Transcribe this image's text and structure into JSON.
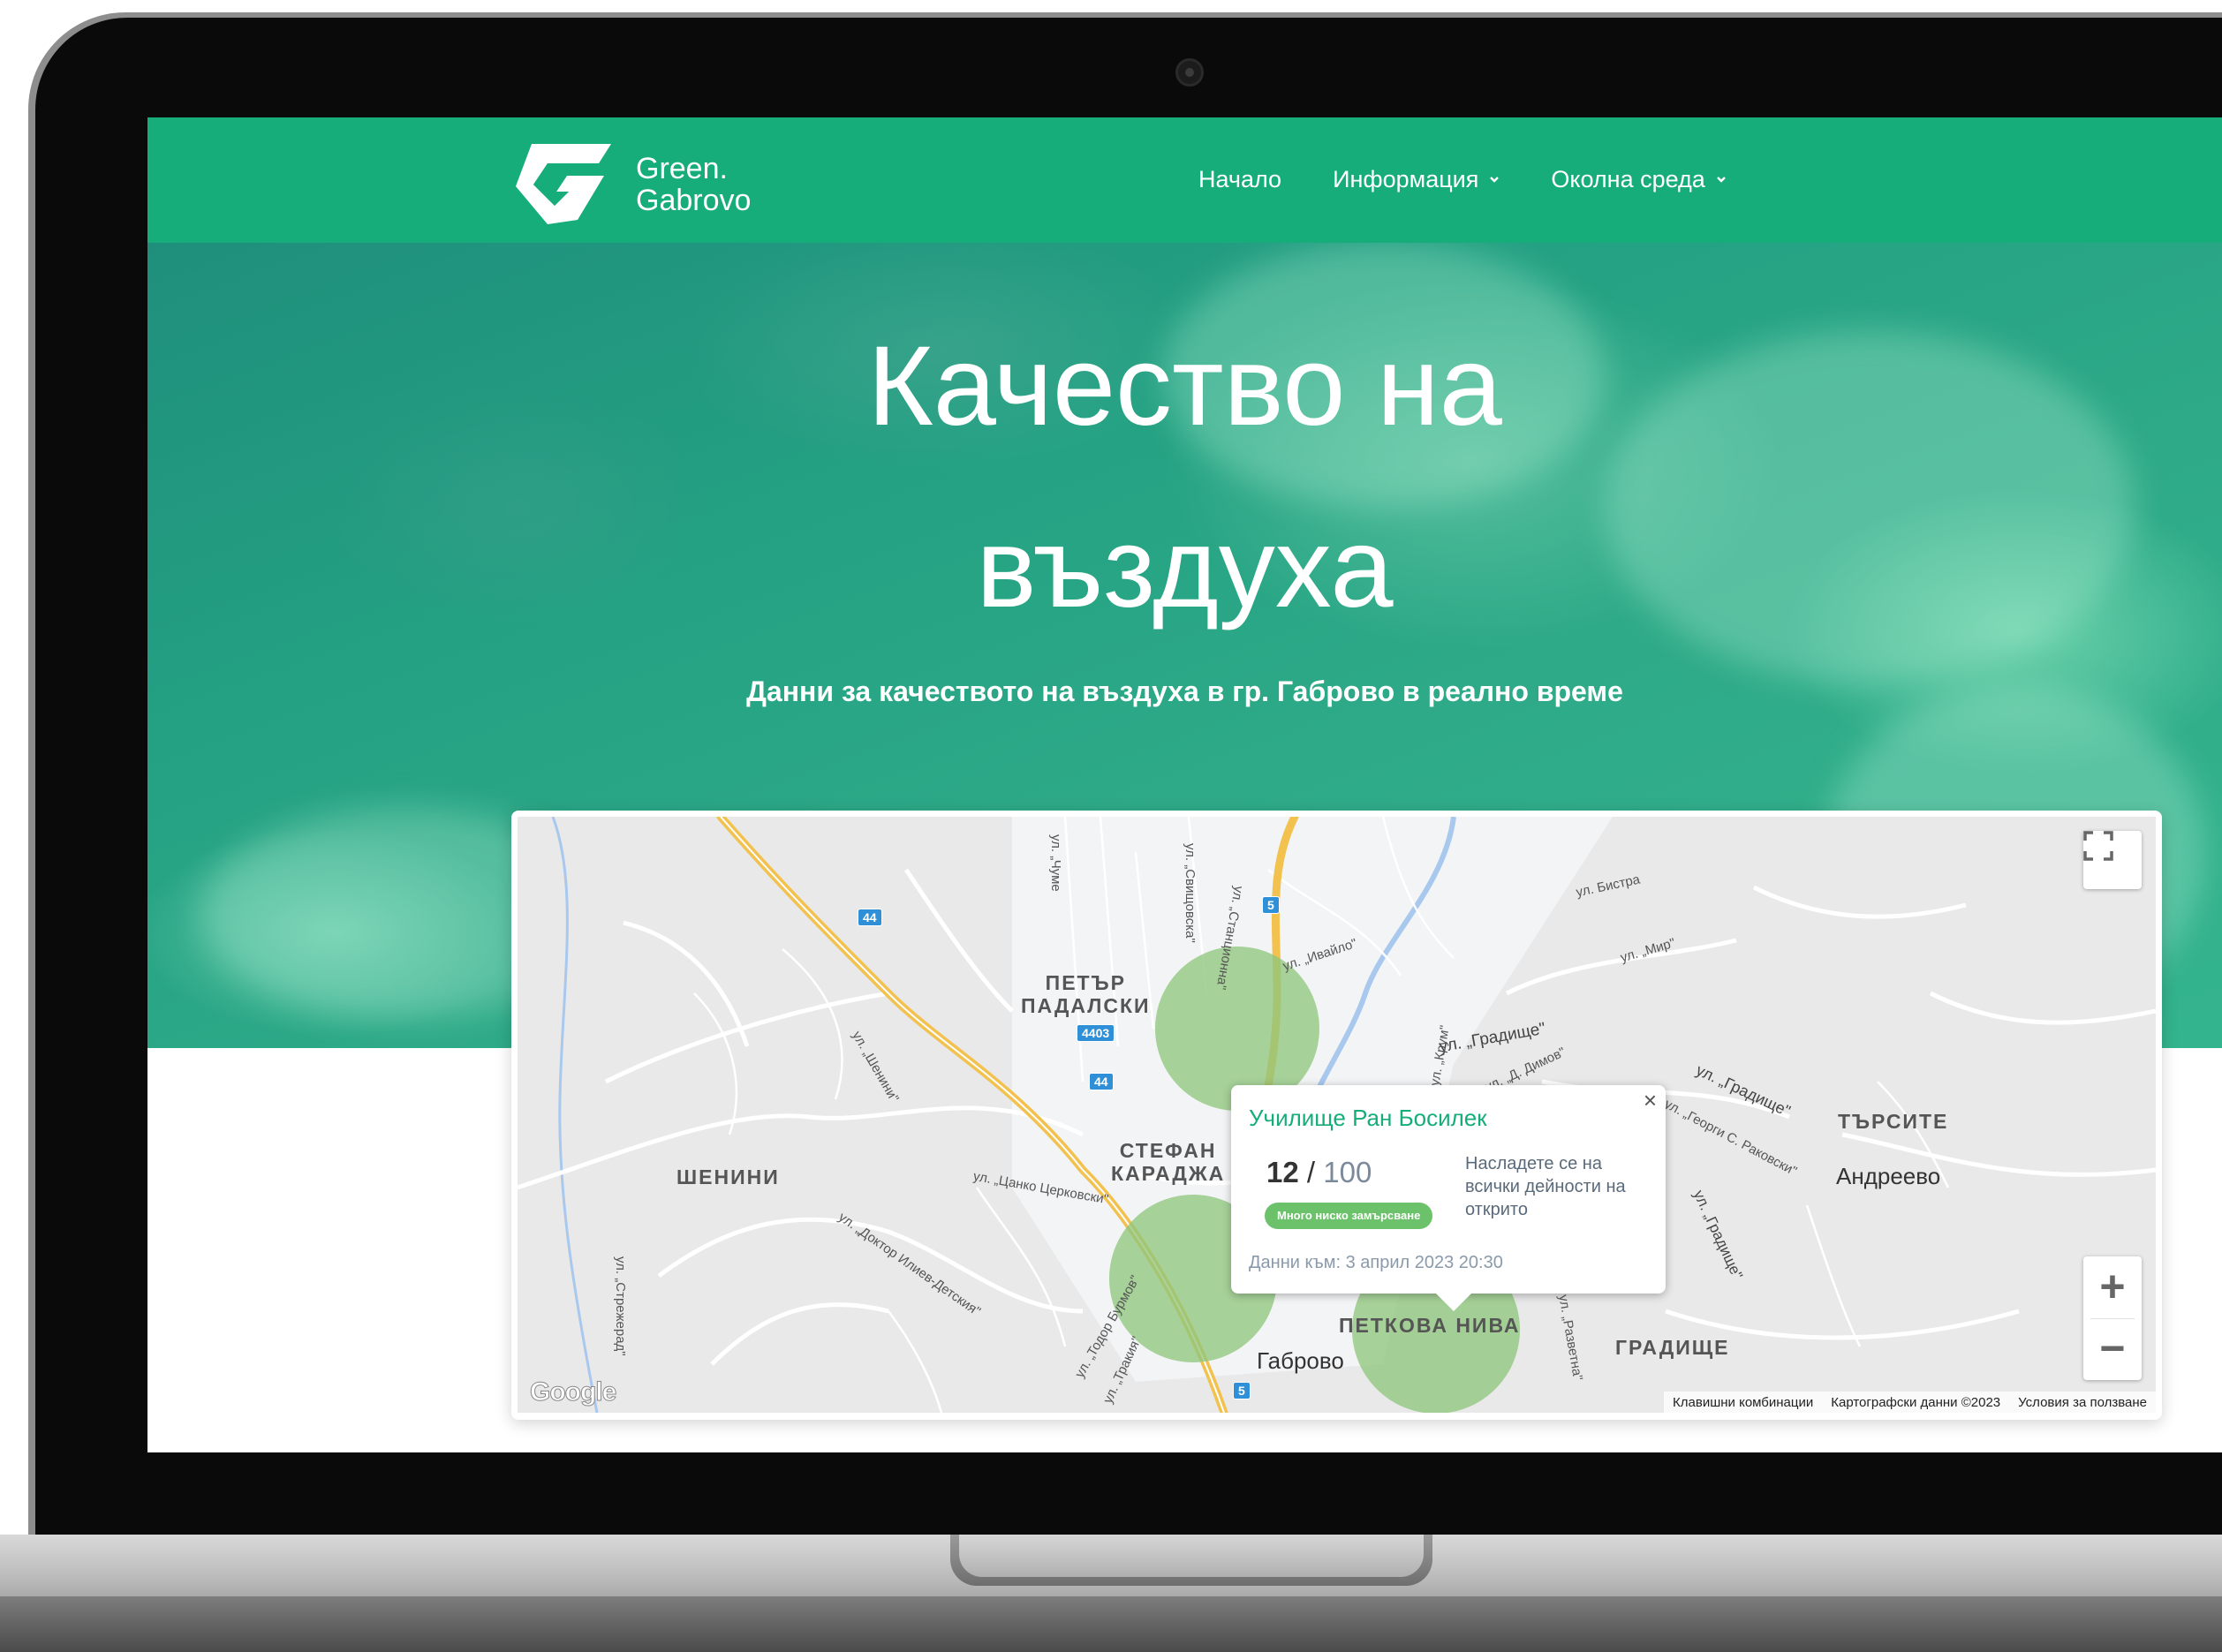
{
  "brand": {
    "line1": "Green.",
    "line2": "Gabrovo"
  },
  "nav": {
    "items": [
      {
        "label": "Начало"
      },
      {
        "label": "Информация"
      },
      {
        "label": "Околна среда"
      }
    ]
  },
  "hero": {
    "title_line1": "Качество на",
    "title_line2": "въздуха",
    "subtitle": "Данни за качеството на въздуха в гр. Габрово в реално време"
  },
  "map": {
    "labels": {
      "petar": "ПЕТЪР\nПАДАЛСКИ",
      "shenini": "ШЕНИНИ",
      "stefan": "СТЕФАН\nКАРАДЖА",
      "tarsite": "ТЪРСИТЕ",
      "andreevo": "Андреево",
      "petkova": "ПЕТКОВА НИВА",
      "gradishte": "ГРАДИЩЕ",
      "gabrovo": "Габрово"
    },
    "streets": {
      "chumeska": "ул. „Чуме",
      "svishtovska": "ул. „Свищовска\"",
      "stantsionna": "ул. „Станционна\"",
      "ivaylo": "ул. „Ивайло\"",
      "bistra": "ул. Бистра",
      "mir": "ул. „Мир\"",
      "gradishte1": "ул. „Градище\"",
      "gradishte2": "ул. „Градище\"",
      "gradishte3": "ул. „Градище\"",
      "sheynin": "ул. „Шенини\"",
      "tsanko": "ул. „Цанко Церковски\"",
      "doktor": "ул. „Доктор Илиев-Детския\"",
      "strezherad": "ул. „Стрежерад\"",
      "todor": "ул. „Тодор Бурмов\"",
      "trakiya": "ул. „Тракия\"",
      "rakovski": "ул. „Георги С. Раковски\"",
      "razvetna": "ул. „Разветна\"",
      "dimov": "ул. „Д. Димов\"",
      "krum": "ул. „Крум\""
    },
    "shields": {
      "s44a": "44",
      "s44b": "44",
      "s4403": "4403",
      "s5a": "5",
      "s5b": "5"
    },
    "attribution": {
      "shortcuts": "Клавишни комбинации",
      "data": "Картографски данни ©2023",
      "terms": "Условия за ползване"
    },
    "google": "Google",
    "zoom_in": "+",
    "zoom_out": "−"
  },
  "info_window": {
    "title": "Училище Ран Босилек",
    "value": "12",
    "separator": "/",
    "max": "100",
    "badge": "Много ниско замърсване",
    "description": "Насладете се на всички дейности на открито",
    "date": "Данни към: 3 април 2023 20:30",
    "close": "×"
  },
  "colors": {
    "brand": "#17ad7b",
    "badge": "#6cc26a",
    "pollution_zone": "#8fc77e"
  },
  "icons": {
    "fullscreen": "fullscreen-icon",
    "dropdown": "chevron-down-icon",
    "close": "close-icon",
    "logo": "green-gabrovo-logo"
  }
}
